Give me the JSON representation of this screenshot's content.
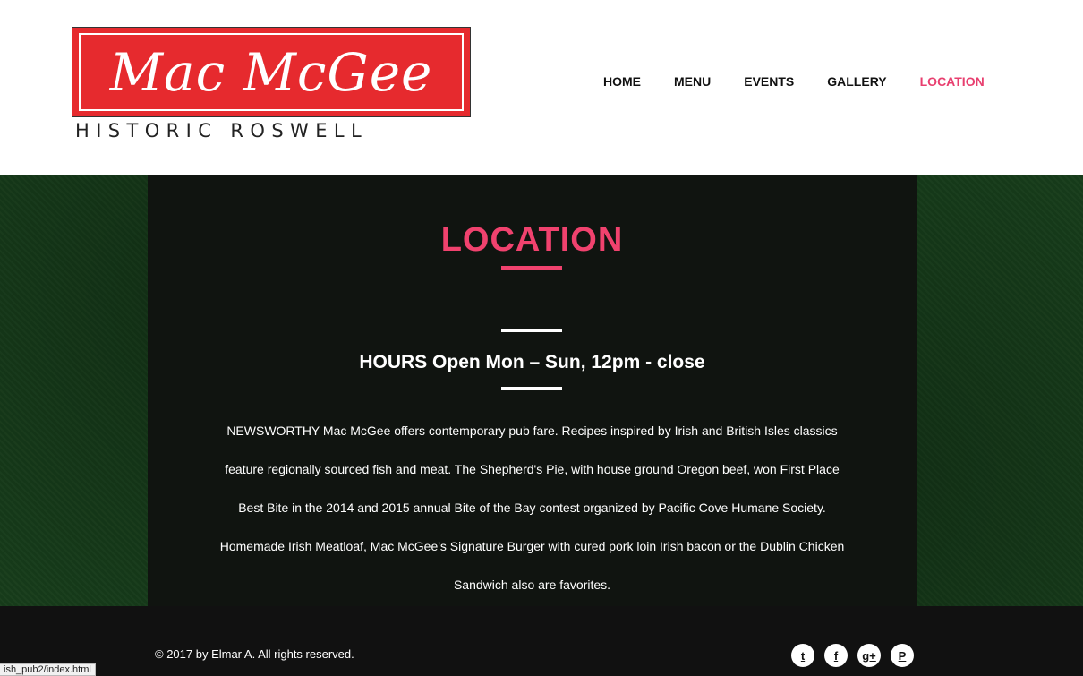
{
  "logo": {
    "title": "Mac McGee",
    "subtitle": "HISTORIC ROSWELL"
  },
  "nav": {
    "items": [
      "HOME",
      "MENU",
      "EVENTS",
      "GALLERY",
      "LOCATION"
    ],
    "active": "LOCATION"
  },
  "main": {
    "title": "LOCATION",
    "hours": "HOURS Open Mon – Sun, 12pm - close",
    "description": "NEWSWORTHY Mac McGee offers contemporary pub fare. Recipes inspired by Irish and British Isles classics feature regionally sourced fish and meat. The Shepherd's Pie, with house ground Oregon beef, won First Place Best Bite in the 2014 and 2015 annual Bite of the Bay contest organized by Pacific Cove Humane Society. Homemade Irish Meatloaf, Mac McGee's Signature Burger with cured pork loin Irish bacon or the Dublin Chicken Sandwich also are favorites."
  },
  "footer": {
    "copyright": "© 2017 by Elmar A. All rights reserved.",
    "social": [
      {
        "name": "twitter-icon",
        "glyph": "t"
      },
      {
        "name": "facebook-icon",
        "glyph": "f"
      },
      {
        "name": "google-plus-icon",
        "glyph": "g+"
      },
      {
        "name": "pinterest-icon",
        "glyph": "P"
      }
    ]
  },
  "status_url": "ish_pub2/index.html",
  "colors": {
    "accent": "#f0426e",
    "logo_red": "#e62a2e",
    "band_green": "#173d1b",
    "panel": "#101410",
    "footer": "#111111"
  }
}
